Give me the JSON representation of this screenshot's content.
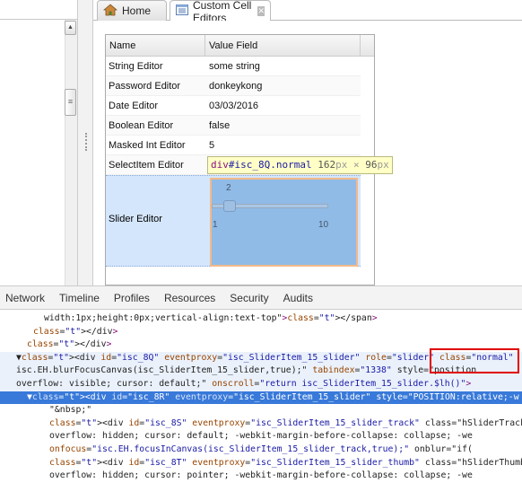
{
  "tabs": [
    {
      "label": "Home",
      "icon": "home-icon"
    },
    {
      "label": "Custom Cell Editors",
      "icon": "list-icon",
      "closable": true
    }
  ],
  "grid": {
    "columns": [
      "Name",
      "Value Field"
    ],
    "rows": [
      {
        "name": "String Editor",
        "value": "some string"
      },
      {
        "name": "Password Editor",
        "value": "donkeykong"
      },
      {
        "name": "Date Editor",
        "value": "03/03/2016"
      },
      {
        "name": "Boolean Editor",
        "value": "false"
      },
      {
        "name": "Masked Int Editor",
        "value": "5"
      },
      {
        "name": "SelectItem Editor",
        "value": ""
      }
    ],
    "slider_row": {
      "name": "Slider Editor",
      "value": "2",
      "min": "1",
      "max": "10",
      "value_fraction": 0.11
    }
  },
  "tooltip": {
    "tag": "div",
    "id": "#isc_8Q",
    "cls": ".normal",
    "w": "162",
    "h": "96",
    "px": "px",
    "x": "×"
  },
  "devtools": {
    "tabs": [
      "Network",
      "Timeline",
      "Profiles",
      "Resources",
      "Security",
      "Audits"
    ],
    "lines": [
      "width:1px;height:0px;vertical-align:text-top\"></span>",
      "</div>",
      "</div>",
      "▼<div id=\"isc_8Q\" eventproxy=\"isc_SliderItem_15_slider\" role=\"slider\" class=\"normal\" ",
      "isc.EH.blurFocusCanvas(isc_SliderItem_15_slider,true);\" tabindex=\"1338\" style=\"position",
      "overflow: visible; cursor: default;\" onscroll=\"return isc_SliderItem_15_slider.$lh()\">",
      "▼<div id=\"isc_8R\" eventproxy=\"isc_SliderItem_15_slider\" style=\"POSITION:relative;-w",
      "\"&nbsp;\"",
      "<div id=\"isc_8S\" eventproxy=\"isc_SliderItem_15_slider_track\" class=\"hSliderTrack",
      "overflow: hidden; cursor: default; -webkit-margin-before-collapse: collapse; -we",
      "onfocus=\"isc.EH.focusInCanvas(isc_SliderItem_15_slider_track,true);\" onblur=\"if(",
      "<div id=\"isc_8T\" eventproxy=\"isc_SliderItem_15_slider_thumb\" class=\"hSliderThumb",
      "overflow: hidden; cursor: pointer; -webkit-margin-before-collapse: collapse; -we"
    ]
  },
  "colors": {
    "selected_line": "#3879d9",
    "highlight_box": "#e00000",
    "slider_overlay": "#90bbe7"
  }
}
